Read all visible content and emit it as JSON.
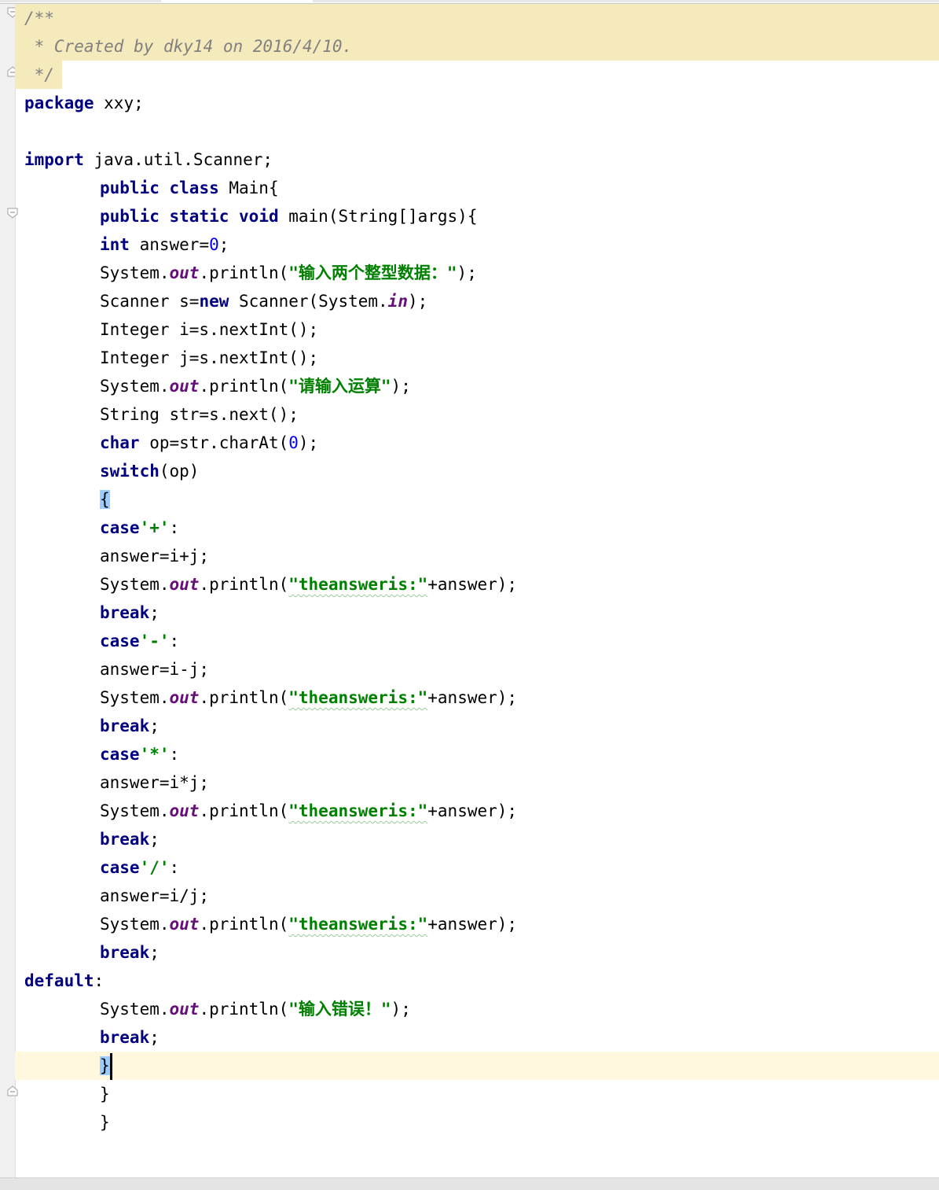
{
  "editor": {
    "lines": [
      {
        "tokens": [
          {
            "t": "/**",
            "c": "cm"
          }
        ]
      },
      {
        "tokens": [
          {
            "t": " * Created by dky14 on 2016/4/10.",
            "c": "cm"
          }
        ]
      },
      {
        "tokens": [
          {
            "t": " */",
            "c": "cm"
          }
        ]
      },
      {
        "tokens": [
          {
            "t": "package",
            "c": "kw"
          },
          {
            "t": " xxy;"
          }
        ]
      },
      {
        "tokens": []
      },
      {
        "tokens": [
          {
            "t": "import",
            "c": "kw"
          },
          {
            "t": " java.util.Scanner;"
          }
        ]
      },
      {
        "tokens": [
          {
            "t": "public",
            "c": "kw"
          },
          {
            "t": " "
          },
          {
            "t": "class",
            "c": "kw"
          },
          {
            "t": " Main{"
          }
        ]
      },
      {
        "tokens": [
          {
            "t": "public",
            "c": "kw"
          },
          {
            "t": " "
          },
          {
            "t": "static",
            "c": "kw"
          },
          {
            "t": " "
          },
          {
            "t": "void",
            "c": "kw"
          },
          {
            "t": " main(String[]args){"
          }
        ]
      },
      {
        "tokens": [
          {
            "t": "int",
            "c": "kw"
          },
          {
            "t": " answer="
          },
          {
            "t": "0",
            "c": "num"
          },
          {
            "t": ";"
          }
        ]
      },
      {
        "tokens": [
          {
            "t": "System."
          },
          {
            "t": "out",
            "c": "fld"
          },
          {
            "t": ".println("
          },
          {
            "t": "\"输入两个整型数据：\"",
            "c": "str"
          },
          {
            "t": ");"
          }
        ]
      },
      {
        "tokens": [
          {
            "t": "Scanner s="
          },
          {
            "t": "new",
            "c": "kw"
          },
          {
            "t": " Scanner(System."
          },
          {
            "t": "in",
            "c": "fld"
          },
          {
            "t": ");"
          }
        ]
      },
      {
        "tokens": [
          {
            "t": "Integer i=s.nextInt();"
          }
        ]
      },
      {
        "tokens": [
          {
            "t": "Integer j=s.nextInt();"
          }
        ]
      },
      {
        "tokens": [
          {
            "t": "System."
          },
          {
            "t": "out",
            "c": "fld"
          },
          {
            "t": ".println("
          },
          {
            "t": "\"请输入运算\"",
            "c": "str"
          },
          {
            "t": ");"
          }
        ]
      },
      {
        "tokens": [
          {
            "t": "String str=s.next();"
          }
        ]
      },
      {
        "tokens": [
          {
            "t": "char",
            "c": "kw"
          },
          {
            "t": " op=str.charAt("
          },
          {
            "t": "0",
            "c": "num"
          },
          {
            "t": ");"
          }
        ]
      },
      {
        "tokens": [
          {
            "t": "switch",
            "c": "kw"
          },
          {
            "t": "(op)"
          }
        ]
      },
      {
        "tokens": [
          {
            "t": "{",
            "c": "brace-hl"
          }
        ]
      },
      {
        "tokens": [
          {
            "t": "case",
            "c": "kw"
          },
          {
            "t": "'+'",
            "c": "str"
          },
          {
            "t": ":"
          }
        ]
      },
      {
        "tokens": [
          {
            "t": "answer=i+j;"
          }
        ]
      },
      {
        "tokens": [
          {
            "t": "System."
          },
          {
            "t": "out",
            "c": "fld"
          },
          {
            "t": ".println("
          },
          {
            "t": "\"theansweris:\"",
            "c": "str squig"
          },
          {
            "t": "+answer);"
          }
        ]
      },
      {
        "tokens": [
          {
            "t": "break",
            "c": "kw"
          },
          {
            "t": ";"
          }
        ]
      },
      {
        "tokens": [
          {
            "t": "case",
            "c": "kw"
          },
          {
            "t": "'-'",
            "c": "str"
          },
          {
            "t": ":"
          }
        ]
      },
      {
        "tokens": [
          {
            "t": "answer=i-j;"
          }
        ]
      },
      {
        "tokens": [
          {
            "t": "System."
          },
          {
            "t": "out",
            "c": "fld"
          },
          {
            "t": ".println("
          },
          {
            "t": "\"theansweris:\"",
            "c": "str squig"
          },
          {
            "t": "+answer);"
          }
        ]
      },
      {
        "tokens": [
          {
            "t": "break",
            "c": "kw"
          },
          {
            "t": ";"
          }
        ]
      },
      {
        "tokens": [
          {
            "t": "case",
            "c": "kw"
          },
          {
            "t": "'*'",
            "c": "str"
          },
          {
            "t": ":"
          }
        ]
      },
      {
        "tokens": [
          {
            "t": "answer=i*j;"
          }
        ]
      },
      {
        "tokens": [
          {
            "t": "System."
          },
          {
            "t": "out",
            "c": "fld"
          },
          {
            "t": ".println("
          },
          {
            "t": "\"theansweris:\"",
            "c": "str squig"
          },
          {
            "t": "+answer);"
          }
        ]
      },
      {
        "tokens": [
          {
            "t": "break",
            "c": "kw"
          },
          {
            "t": ";"
          }
        ]
      },
      {
        "tokens": [
          {
            "t": "case",
            "c": "kw"
          },
          {
            "t": "'/'",
            "c": "str"
          },
          {
            "t": ":"
          }
        ]
      },
      {
        "tokens": [
          {
            "t": "answer=i/j;"
          }
        ]
      },
      {
        "tokens": [
          {
            "t": "System."
          },
          {
            "t": "out",
            "c": "fld"
          },
          {
            "t": ".println("
          },
          {
            "t": "\"theansweris:\"",
            "c": "str squig"
          },
          {
            "t": "+answer);"
          }
        ]
      },
      {
        "tokens": [
          {
            "t": "break",
            "c": "kw"
          },
          {
            "t": ";"
          }
        ]
      },
      {
        "tokens": [
          {
            "t": "default",
            "c": "kw"
          },
          {
            "t": ":"
          }
        ]
      },
      {
        "tokens": [
          {
            "t": "System."
          },
          {
            "t": "out",
            "c": "fld"
          },
          {
            "t": ".println("
          },
          {
            "t": "\"输入错误！\"",
            "c": "str"
          },
          {
            "t": ");"
          }
        ]
      },
      {
        "tokens": [
          {
            "t": "break",
            "c": "kw"
          },
          {
            "t": ";"
          }
        ]
      },
      {
        "tokens": [
          {
            "t": "}",
            "c": "brace-hl"
          },
          {
            "t": "",
            "c": "caret"
          }
        ]
      },
      {
        "tokens": [
          {
            "t": "}"
          }
        ]
      },
      {
        "tokens": [
          {
            "t": "}"
          }
        ]
      }
    ]
  }
}
